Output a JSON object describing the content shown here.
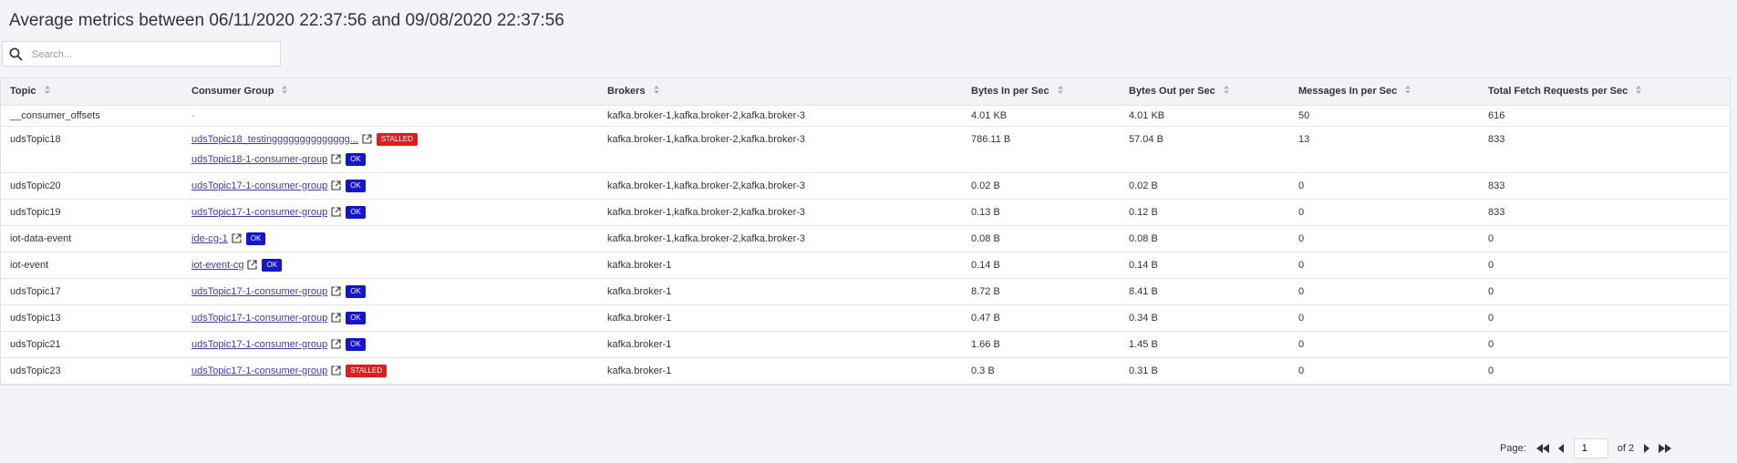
{
  "header": {
    "title": "Average metrics between 06/11/2020 22:37:56 and 09/08/2020 22:37:56"
  },
  "search": {
    "placeholder": "Search...",
    "icon": "search-icon"
  },
  "table": {
    "columns": [
      "Topic",
      "Consumer Group",
      "Brokers",
      "Bytes In per Sec",
      "Bytes Out per Sec",
      "Messages In per Sec",
      "Total Fetch Requests per Sec"
    ],
    "rows": [
      {
        "topic": "__consumer_offsets",
        "groups": [],
        "no_group": "-",
        "brokers": "kafka.broker-1,kafka.broker-2,kafka.broker-3",
        "bytes_in": "4.01 KB",
        "bytes_out": "4.01 KB",
        "messages_in": "50",
        "fetch_requests": "616"
      },
      {
        "topic": "udsTopic18",
        "groups": [
          {
            "name": "udsTopic18_testingggggggggggggg...",
            "status": "STALLED"
          },
          {
            "name": "udsTopic18-1-consumer-group",
            "status": "OK"
          }
        ],
        "brokers": "kafka.broker-1,kafka.broker-2,kafka.broker-3",
        "bytes_in": "786.11 B",
        "bytes_out": "57.04 B",
        "messages_in": "13",
        "fetch_requests": "833"
      },
      {
        "topic": "udsTopic20",
        "groups": [
          {
            "name": "udsTopic17-1-consumer-group",
            "status": "OK"
          }
        ],
        "brokers": "kafka.broker-1,kafka.broker-2,kafka.broker-3",
        "bytes_in": "0.02 B",
        "bytes_out": "0.02 B",
        "messages_in": "0",
        "fetch_requests": "833"
      },
      {
        "topic": "udsTopic19",
        "groups": [
          {
            "name": "udsTopic17-1-consumer-group",
            "status": "OK"
          }
        ],
        "brokers": "kafka.broker-1,kafka.broker-2,kafka.broker-3",
        "bytes_in": "0.13 B",
        "bytes_out": "0.12 B",
        "messages_in": "0",
        "fetch_requests": "833"
      },
      {
        "topic": "iot-data-event",
        "groups": [
          {
            "name": "ide-cg-1",
            "status": "OK"
          }
        ],
        "brokers": "kafka.broker-1,kafka.broker-2,kafka.broker-3",
        "bytes_in": "0.08 B",
        "bytes_out": "0.08 B",
        "messages_in": "0",
        "fetch_requests": "0"
      },
      {
        "topic": "iot-event",
        "groups": [
          {
            "name": "iot-event-cg",
            "status": "OK"
          }
        ],
        "brokers": "kafka.broker-1",
        "bytes_in": "0.14 B",
        "bytes_out": "0.14 B",
        "messages_in": "0",
        "fetch_requests": "0"
      },
      {
        "topic": "udsTopic17",
        "groups": [
          {
            "name": "udsTopic17-1-consumer-group",
            "status": "OK"
          }
        ],
        "brokers": "kafka.broker-1",
        "bytes_in": "8.72 B",
        "bytes_out": "8.41 B",
        "messages_in": "0",
        "fetch_requests": "0"
      },
      {
        "topic": "udsTopic13",
        "groups": [
          {
            "name": "udsTopic17-1-consumer-group",
            "status": "OK"
          }
        ],
        "brokers": "kafka.broker-1",
        "bytes_in": "0.47 B",
        "bytes_out": "0.34 B",
        "messages_in": "0",
        "fetch_requests": "0"
      },
      {
        "topic": "udsTopic21",
        "groups": [
          {
            "name": "udsTopic17-1-consumer-group",
            "status": "OK"
          }
        ],
        "brokers": "kafka.broker-1",
        "bytes_in": "1.66 B",
        "bytes_out": "1.45 B",
        "messages_in": "0",
        "fetch_requests": "0"
      },
      {
        "topic": "udsTopic23",
        "groups": [
          {
            "name": "udsTopic17-1-consumer-group",
            "status": "STALLED"
          }
        ],
        "brokers": "kafka.broker-1",
        "bytes_in": "0.3 B",
        "bytes_out": "0.31 B",
        "messages_in": "0",
        "fetch_requests": "0"
      }
    ]
  },
  "status_colors": {
    "OK": "#1515cc",
    "STALLED": "#e21b1b"
  },
  "pagination": {
    "page_label": "Page:",
    "current_page": "1",
    "total_label": "of 2"
  }
}
